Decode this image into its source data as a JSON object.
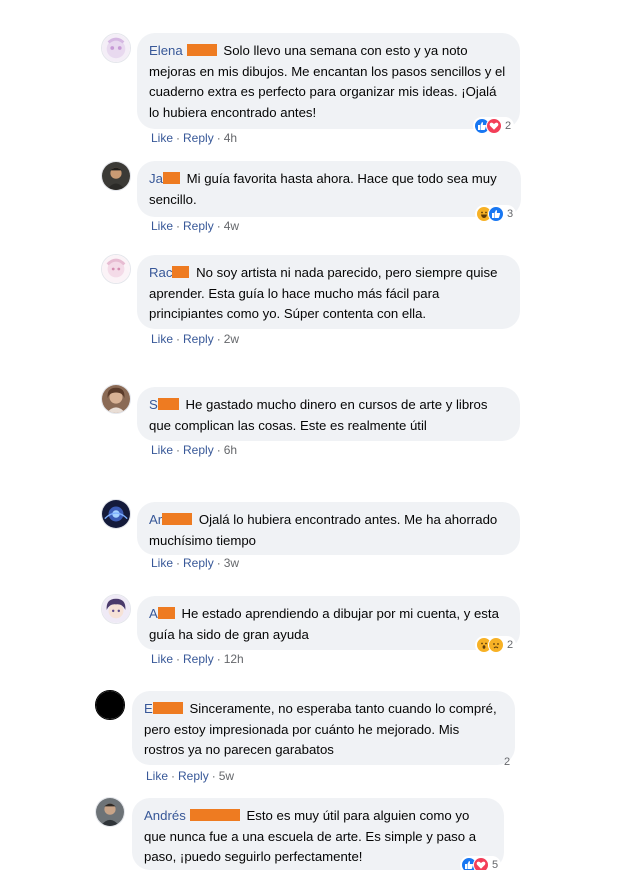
{
  "actions": {
    "like": "Like",
    "reply": "Reply",
    "separator": "·"
  },
  "colors": {
    "link": "#385898",
    "bubble": "#f0f2f5",
    "redaction": "#ee7b21"
  },
  "comments": [
    {
      "author": "Elena",
      "text": "Solo llevo una semana con esto y ya noto mejoras en mis dibujos. Me encantan los pasos sencillos y el cuaderno extra es perfecto para organizar mis ideas. ¡Ojalá lo hubiera encontrado antes!",
      "time": "4h",
      "reactions": [
        "like-icon",
        "love-icon"
      ],
      "reaction_count": "2"
    },
    {
      "author": "Ja",
      "text": "Mi guía favorita hasta ahora. Hace que todo sea muy sencillo.",
      "time": "4w",
      "reactions": [
        "haha-icon",
        "like-icon"
      ],
      "reaction_count": "3"
    },
    {
      "author": "Rac",
      "text": "No soy artista ni nada parecido, pero siempre quise aprender. Esta guía lo hace mucho más fácil para principiantes como yo. Súper contenta con ella.",
      "time": "2w"
    },
    {
      "author": "S",
      "text": "He gastado mucho dinero en cursos de arte y libros que complican las cosas. Este es realmente útil",
      "time": "6h"
    },
    {
      "author": "Ar",
      "text": "Ojalá lo hubiera encontrado antes. Me ha ahorrado muchísimo tiempo",
      "time": "3w"
    },
    {
      "author": "A",
      "text": "He estado aprendiendo a dibujar por mi cuenta, y esta guía ha sido de gran ayuda",
      "time": "12h",
      "reactions": [
        "wow-icon",
        "sad-icon"
      ],
      "reaction_count": "2"
    },
    {
      "author": "E",
      "text": "Sinceramente, no esperaba tanto cuando lo compré, pero estoy impresionada por cuánto he mejorado. Mis rostros ya no parecen garabatos",
      "time": "5w",
      "reaction_count": "2"
    },
    {
      "author": "Andrés",
      "text": "Esto es muy útil para alguien como yo que nunca fue a una escuela de arte. Es simple y paso a paso, ¡puedo seguirlo perfectamente!",
      "time": "",
      "reactions": [
        "like-icon",
        "love-icon"
      ],
      "reaction_count": "5"
    }
  ]
}
